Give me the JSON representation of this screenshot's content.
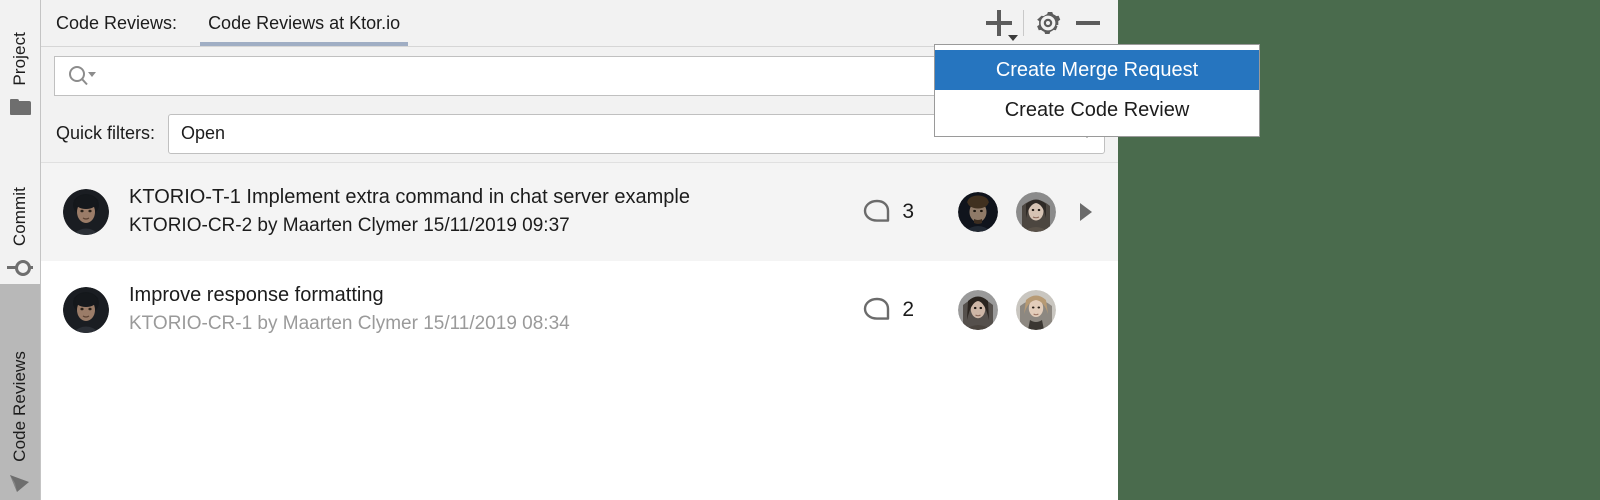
{
  "theme": {
    "accent_blue": "#2675bf",
    "editor_background": "#4a6b4d",
    "panel_background": "#ffffff",
    "chrome_background": "#f2f2f2",
    "tab_underline": "#a0aec4",
    "selected_row": "#f4f4f4",
    "muted_text": "#9a9a9a"
  },
  "toolstrip": {
    "items": [
      {
        "label": "Project",
        "icon": "folder-icon",
        "active": false
      },
      {
        "label": "Commit",
        "icon": "commit-icon",
        "active": false
      },
      {
        "label": "Code Reviews",
        "icon": "space-icon",
        "active": true
      }
    ]
  },
  "header": {
    "title": "Code Reviews:",
    "tab_label": "Code Reviews at Ktor.io",
    "actions": {
      "add_label": "+",
      "add_icon": "plus-dropdown-icon",
      "settings_icon": "gear-icon",
      "minimize_icon": "minus-icon"
    }
  },
  "search": {
    "value": "",
    "placeholder": "",
    "icon": "search-dropdown-icon"
  },
  "filters": {
    "label": "Quick filters:",
    "selected": "Open",
    "options": [
      "Open"
    ],
    "caret_icon": "chevron-down-icon"
  },
  "popup_menu": {
    "items": [
      {
        "label": "Create Merge Request",
        "highlighted": true
      },
      {
        "label": "Create Code Review",
        "highlighted": false
      }
    ]
  },
  "reviews": [
    {
      "title": "KTORIO-T-1 Implement extra command in chat server example",
      "subtitle": "KTORIO-CR-2 by Maarten Clymer 15/11/2019 09:37",
      "subtitle_muted": false,
      "comment_count": "3",
      "comment_icon": "comment-bubble-icon",
      "selected": true,
      "has_expand_arrow": true,
      "participant_count": 2
    },
    {
      "title": "Improve response formatting",
      "subtitle": "KTORIO-CR-1 by Maarten Clymer 15/11/2019 08:34",
      "subtitle_muted": true,
      "comment_count": "2",
      "comment_icon": "comment-bubble-icon",
      "selected": false,
      "has_expand_arrow": false,
      "participant_count": 2
    }
  ]
}
